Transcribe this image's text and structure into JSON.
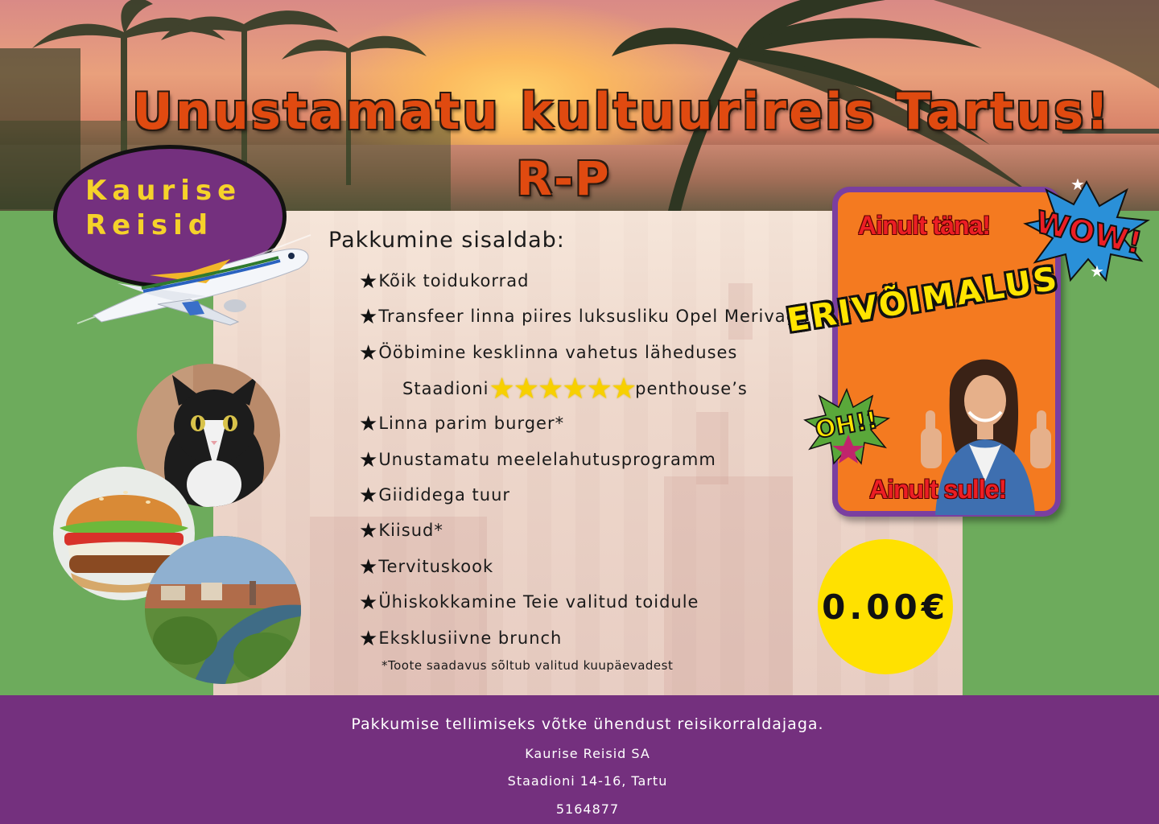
{
  "header": {
    "title": "Unustamatu kultuurireis Tartus!",
    "subtitle": "R-P"
  },
  "logo": {
    "line1": "Kaurise",
    "line2": "Reisid"
  },
  "offer_list": {
    "heading": "Pakkumine sisaldab:",
    "items": [
      "Kõik toidukorrad",
      "Transfeer linna piires luksusliku Opel Merivaga",
      "Ööbimine kesklinna vahetus läheduses",
      "Linna parim burger*",
      "Unustamatu meelelahutusprogramm",
      "Giididega tuur",
      "Kiisud*",
      "Tervituskook",
      "Ühiskokkamine Teie valitud toidule",
      "Eksklusiivne brunch"
    ],
    "stars_line": {
      "before": "Staadioni",
      "after": "penthouse’s",
      "star_count": 6
    },
    "footnote": "*Toote saadavus sõltub valitud kuupäevadest"
  },
  "promo": {
    "top": "Ainult täna!",
    "bottom": "Ainult sulle!",
    "headline": "ERIVÕIMALUS",
    "wow": "WOW!",
    "oh": "OH!!"
  },
  "price": "0.00€",
  "footer": {
    "line1": "Pakkumise tellimiseks võtke ühendust reisikorraldajaga.",
    "line2": "Kaurise Reisid SA",
    "line3": "Staadioni 14-16, Tartu",
    "line4": "5164877"
  },
  "colors": {
    "green": "#6dab5c",
    "purple": "#74307e",
    "orange": "#f47a20",
    "title": "#e04a10",
    "yellow": "#ffe100",
    "red": "#ec1e24"
  }
}
